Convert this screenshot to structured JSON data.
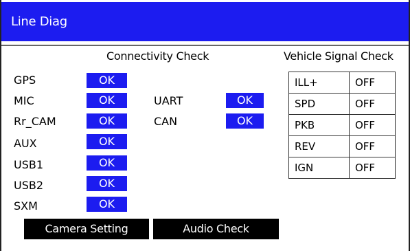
{
  "window": {
    "title": "Line Diag"
  },
  "connectivity": {
    "title": "Connectivity Check",
    "left": [
      {
        "label": "GPS",
        "status": "OK"
      },
      {
        "label": "MIC",
        "status": "OK"
      },
      {
        "label": "Rr_CAM",
        "status": "OK"
      },
      {
        "label": "AUX",
        "status": "OK"
      },
      {
        "label": "USB1",
        "status": "OK"
      },
      {
        "label": "USB2",
        "status": "OK"
      },
      {
        "label": "SXM",
        "status": "OK"
      }
    ],
    "right": [
      {
        "label": "UART",
        "status": "OK"
      },
      {
        "label": "CAN",
        "status": "OK"
      }
    ]
  },
  "vehicle": {
    "title": "Vehicle Signal Check",
    "signals": [
      {
        "label": "ILL+",
        "value": "OFF"
      },
      {
        "label": "SPD",
        "value": "OFF"
      },
      {
        "label": "PKB",
        "value": "OFF"
      },
      {
        "label": "REV",
        "value": "OFF"
      },
      {
        "label": "IGN",
        "value": "OFF"
      }
    ]
  },
  "buttons": {
    "camera_setting": "Camera Setting",
    "audio_check": "Audio Check"
  },
  "colors": {
    "accent": "#1c1cf0",
    "button_bg": "#000000"
  }
}
